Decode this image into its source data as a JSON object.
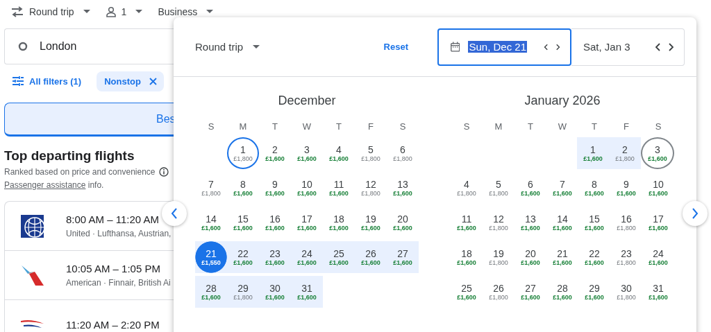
{
  "search_bar": {
    "trip_type": "Round trip",
    "passengers": "1",
    "cabin": "Business"
  },
  "origin": {
    "value": "London"
  },
  "filters": {
    "all_filters": "All filters (1)",
    "chips": [
      {
        "label": "Nonstop",
        "selected": true
      }
    ]
  },
  "sort_tabs": [
    {
      "label": "Bes",
      "selected": true
    }
  ],
  "results": {
    "title": "Top departing flights",
    "subtitle": "Ranked based on price and convenience",
    "assist_link": "Passenger assistance",
    "assist_rest": " info.",
    "flights": [
      {
        "kind": "globe",
        "times": "8:00 AM – 11:20 AM",
        "airlines": "United · Lufthansa, Austrian,"
      },
      {
        "kind": "tail",
        "times": "10:05 AM – 1:05 PM",
        "airlines": "American · Finnair, British Ai"
      },
      {
        "kind": "stripe",
        "times": "11:20 AM – 2:20 PM"
      }
    ]
  },
  "date_picker": {
    "trip_type": "Round trip",
    "reset": "Reset",
    "departure": {
      "value": "Sun, Dec 21",
      "focused": true
    },
    "return": {
      "value": "Sat, Jan 3",
      "focused": false
    },
    "months": [
      {
        "name": "December",
        "weekdays": [
          "S",
          "M",
          "T",
          "W",
          "T",
          "F",
          "S"
        ],
        "weeks": [
          [
            {
              "day": "1",
              "price": "£1,800",
              "cheap": false,
              "in_range": false,
              "kind": "today"
            },
            {
              "day": "2",
              "price": "£1,600",
              "cheap": true,
              "in_range": false,
              "kind": "day"
            },
            {
              "day": "3",
              "price": "£1,600",
              "cheap": true,
              "in_range": false,
              "kind": "day"
            },
            {
              "day": "4",
              "price": "£1,600",
              "cheap": true,
              "in_range": false,
              "kind": "day"
            },
            {
              "day": "5",
              "price": "£1,800",
              "cheap": false,
              "in_range": false,
              "kind": "day"
            },
            {
              "day": "6",
              "price": "£1,800",
              "cheap": false,
              "in_range": false,
              "kind": "day"
            }
          ],
          [
            {
              "day": "7",
              "price": "£1,800",
              "cheap": false,
              "in_range": false,
              "kind": "day"
            },
            {
              "day": "8",
              "price": "£1,600",
              "cheap": true,
              "in_range": false,
              "kind": "day"
            },
            {
              "day": "9",
              "price": "£1,600",
              "cheap": true,
              "in_range": false,
              "kind": "day"
            },
            {
              "day": "10",
              "price": "£1,600",
              "cheap": true,
              "in_range": false,
              "kind": "day"
            },
            {
              "day": "11",
              "price": "£1,600",
              "cheap": true,
              "in_range": false,
              "kind": "day"
            },
            {
              "day": "12",
              "price": "£1,800",
              "cheap": false,
              "in_range": false,
              "kind": "day"
            },
            {
              "day": "13",
              "price": "£1,600",
              "cheap": true,
              "in_range": false,
              "kind": "day"
            }
          ],
          [
            {
              "day": "14",
              "price": "£1,600",
              "cheap": true,
              "in_range": false,
              "kind": "day"
            },
            {
              "day": "15",
              "price": "£1,600",
              "cheap": true,
              "in_range": false,
              "kind": "day"
            },
            {
              "day": "16",
              "price": "£1,600",
              "cheap": true,
              "in_range": false,
              "kind": "day"
            },
            {
              "day": "17",
              "price": "£1,600",
              "cheap": true,
              "in_range": false,
              "kind": "day"
            },
            {
              "day": "18",
              "price": "£1,600",
              "cheap": true,
              "in_range": false,
              "kind": "day"
            },
            {
              "day": "19",
              "price": "£1,600",
              "cheap": true,
              "in_range": false,
              "kind": "day"
            },
            {
              "day": "20",
              "price": "£1,600",
              "cheap": true,
              "in_range": false,
              "kind": "day"
            }
          ],
          [
            {
              "day": "21",
              "price": "£1,550",
              "cheap": true,
              "in_range": true,
              "kind": "start"
            },
            {
              "day": "22",
              "price": "£1,600",
              "cheap": true,
              "in_range": true,
              "kind": "day"
            },
            {
              "day": "23",
              "price": "£1,600",
              "cheap": true,
              "in_range": true,
              "kind": "day"
            },
            {
              "day": "24",
              "price": "£1,600",
              "cheap": true,
              "in_range": true,
              "kind": "day"
            },
            {
              "day": "25",
              "price": "£1,600",
              "cheap": true,
              "in_range": true,
              "kind": "day"
            },
            {
              "day": "26",
              "price": "£1,600",
              "cheap": true,
              "in_range": true,
              "kind": "day"
            },
            {
              "day": "27",
              "price": "£1,600",
              "cheap": true,
              "in_range": true,
              "kind": "day"
            }
          ],
          [
            {
              "day": "28",
              "price": "£1,600",
              "cheap": true,
              "in_range": true,
              "kind": "day"
            },
            {
              "day": "29",
              "price": "£1,800",
              "cheap": false,
              "in_range": true,
              "kind": "day"
            },
            {
              "day": "30",
              "price": "£1,600",
              "cheap": true,
              "in_range": true,
              "kind": "day"
            },
            {
              "day": "31",
              "price": "£1,600",
              "cheap": true,
              "in_range": true,
              "kind": "day"
            }
          ]
        ]
      },
      {
        "name": "January 2026",
        "weekdays": [
          "S",
          "M",
          "T",
          "W",
          "T",
          "F",
          "S"
        ],
        "weeks": [
          [
            {
              "day": "1",
              "price": "£1,600",
              "cheap": true,
              "in_range": true,
              "kind": "day"
            },
            {
              "day": "2",
              "price": "£1,800",
              "cheap": false,
              "in_range": true,
              "kind": "day"
            },
            {
              "day": "3",
              "price": "£1,600",
              "cheap": true,
              "in_range": false,
              "kind": "end"
            }
          ],
          [
            {
              "day": "4",
              "price": "£1,800",
              "cheap": false,
              "in_range": false,
              "kind": "day"
            },
            {
              "day": "5",
              "price": "£1,800",
              "cheap": false,
              "in_range": false,
              "kind": "day"
            },
            {
              "day": "6",
              "price": "£1,600",
              "cheap": true,
              "in_range": false,
              "kind": "day"
            },
            {
              "day": "7",
              "price": "£1,600",
              "cheap": true,
              "in_range": false,
              "kind": "day"
            },
            {
              "day": "8",
              "price": "£1,600",
              "cheap": true,
              "in_range": false,
              "kind": "day"
            },
            {
              "day": "9",
              "price": "£1,600",
              "cheap": true,
              "in_range": false,
              "kind": "day"
            },
            {
              "day": "10",
              "price": "£1,600",
              "cheap": true,
              "in_range": false,
              "kind": "day"
            }
          ],
          [
            {
              "day": "11",
              "price": "£1,600",
              "cheap": true,
              "in_range": false,
              "kind": "day"
            },
            {
              "day": "12",
              "price": "£1,800",
              "cheap": false,
              "in_range": false,
              "kind": "day"
            },
            {
              "day": "13",
              "price": "£1,600",
              "cheap": true,
              "in_range": false,
              "kind": "day"
            },
            {
              "day": "14",
              "price": "£1,600",
              "cheap": true,
              "in_range": false,
              "kind": "day"
            },
            {
              "day": "15",
              "price": "£1,600",
              "cheap": true,
              "in_range": false,
              "kind": "day"
            },
            {
              "day": "16",
              "price": "£1,800",
              "cheap": false,
              "in_range": false,
              "kind": "day"
            },
            {
              "day": "17",
              "price": "£1,600",
              "cheap": true,
              "in_range": false,
              "kind": "day"
            }
          ],
          [
            {
              "day": "18",
              "price": "£1,600",
              "cheap": true,
              "in_range": false,
              "kind": "day"
            },
            {
              "day": "19",
              "price": "£1,800",
              "cheap": false,
              "in_range": false,
              "kind": "day"
            },
            {
              "day": "20",
              "price": "£1,600",
              "cheap": true,
              "in_range": false,
              "kind": "day"
            },
            {
              "day": "21",
              "price": "£1,600",
              "cheap": true,
              "in_range": false,
              "kind": "day"
            },
            {
              "day": "22",
              "price": "£1,600",
              "cheap": true,
              "in_range": false,
              "kind": "day"
            },
            {
              "day": "23",
              "price": "£1,800",
              "cheap": false,
              "in_range": false,
              "kind": "day"
            },
            {
              "day": "24",
              "price": "£1,600",
              "cheap": true,
              "in_range": false,
              "kind": "day"
            }
          ],
          [
            {
              "day": "25",
              "price": "£1,600",
              "cheap": true,
              "in_range": false,
              "kind": "day"
            },
            {
              "day": "26",
              "price": "£1,800",
              "cheap": false,
              "in_range": false,
              "kind": "day"
            },
            {
              "day": "27",
              "price": "£1,600",
              "cheap": true,
              "in_range": false,
              "kind": "day"
            },
            {
              "day": "28",
              "price": "£1,600",
              "cheap": true,
              "in_range": false,
              "kind": "day"
            },
            {
              "day": "29",
              "price": "£1,600",
              "cheap": true,
              "in_range": false,
              "kind": "day"
            },
            {
              "day": "30",
              "price": "£1,800",
              "cheap": false,
              "in_range": false,
              "kind": "day"
            },
            {
              "day": "31",
              "price": "£1,600",
              "cheap": true,
              "in_range": false,
              "kind": "day"
            }
          ]
        ]
      }
    ]
  }
}
